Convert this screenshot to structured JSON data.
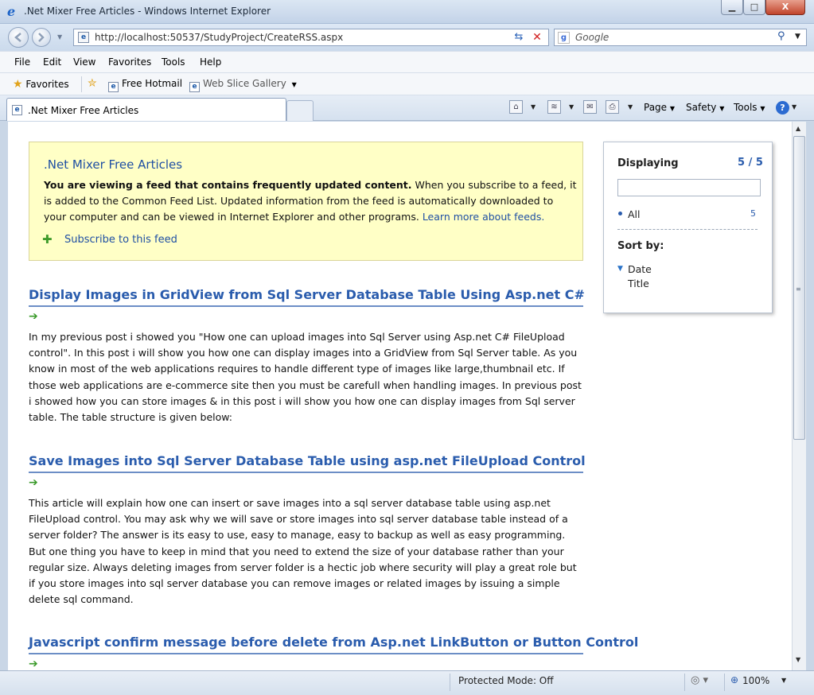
{
  "window": {
    "title": ".Net Mixer Free Articles - Windows Internet Explorer",
    "minimize_glyph": "▁",
    "maximize_glyph": "□",
    "close_glyph": "X"
  },
  "address_bar": {
    "url": "http://localhost:50537/StudyProject/CreateRSS.aspx"
  },
  "search": {
    "placeholder": "Google",
    "engine_icon": "g-icon"
  },
  "menu": [
    "File",
    "Edit",
    "View",
    "Favorites",
    "Tools",
    "Help"
  ],
  "favorites_bar": {
    "favorites_label": "Favorites",
    "items": [
      "Free Hotmail",
      "Web Slice Gallery"
    ]
  },
  "tabs": {
    "active_label": ".Net Mixer Free Articles"
  },
  "command_bar": {
    "page_label": "Page",
    "safety_label": "Safety",
    "tools_label": "Tools",
    "help_glyph": "?"
  },
  "feed": {
    "title": ".Net Mixer Free Articles",
    "intro_bold": "You are viewing a feed that contains frequently updated content.",
    "intro_text": " When you subscribe to a feed, it is added to the Common Feed List. Updated information from the feed is automatically downloaded to your computer and can be viewed in Internet Explorer and other programs. ",
    "learn_more_link": "Learn more about feeds.",
    "subscribe_link": "Subscribe to this feed"
  },
  "articles": [
    {
      "title": "Display Images in GridView from Sql Server Database Table Using Asp.net C#",
      "body": "In my previous post i showed you \"How one can upload images into Sql Server using Asp.net C# FileUpload control\". In this post i will show you how one can display images into a GridView from Sql Server table. As you know in most of the web applications requires to handle different type of images like large,thumbnail etc. If those web applications are e-commerce site then you must be carefull when handling images. In previous post i showed how you can store images & in this post i will show you how one can display images from Sql server table. The table structure is given below:"
    },
    {
      "title": "Save Images into Sql Server Database Table using asp.net FileUpload Control",
      "body": "This article will explain how one can insert or save images into a sql server database table using asp.net FileUpload control. You may ask why we will save or store images into sql server database table instead of a server folder? The answer is its easy to use, easy to manage, easy to backup as well as easy programming. But one thing you have to keep in mind that you need to extend the size of your database rather than your regular size. Always deleting images from server folder is a hectic job where security will play a great role but if you store images into sql server database you can remove images or related images by issuing a simple delete sql command."
    },
    {
      "title": "Javascript confirm message before delete from Asp.net LinkButton or Button Control",
      "body": ""
    }
  ],
  "side_panel": {
    "displaying_label": "Displaying",
    "displaying_count": "5 / 5",
    "all_label": "All",
    "all_count": "5",
    "sort_label": "Sort by:",
    "sort_options": [
      "Date",
      "Title"
    ]
  },
  "status_bar": {
    "protected_mode": "Protected Mode: Off",
    "zoom": "100%"
  },
  "colors": {
    "link_blue": "#2a5cad",
    "feed_box_bg": "#ffffc6",
    "arrow_green": "#3a9a2a"
  }
}
